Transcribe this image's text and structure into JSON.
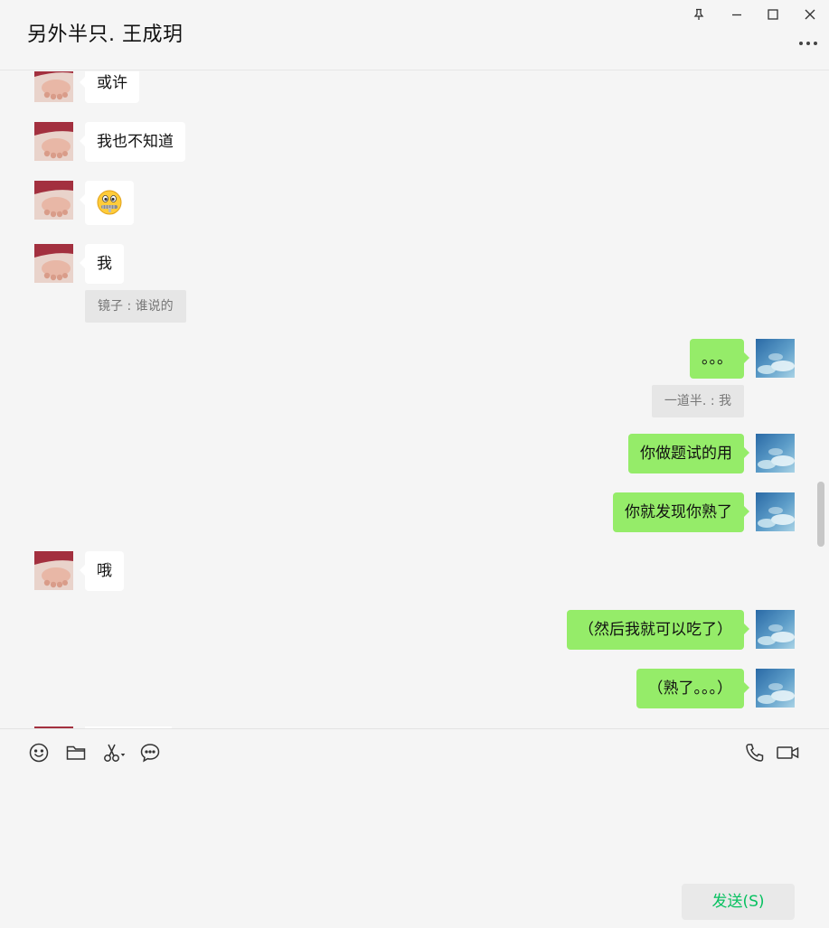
{
  "window": {
    "title": "另外半只. 王成玥"
  },
  "messages": [
    {
      "side": "in",
      "text": "或许"
    },
    {
      "side": "in",
      "text": "我也不知道"
    },
    {
      "side": "in",
      "emoji": "zipper-mouth-face"
    },
    {
      "side": "in",
      "text": "我",
      "quote": "镜子 : 谁说的"
    },
    {
      "side": "out",
      "text": "。。。",
      "quote": "一道半. : 我"
    },
    {
      "side": "out",
      "text": "你做题试的用"
    },
    {
      "side": "out",
      "text": "你就发现你熟了"
    },
    {
      "side": "in",
      "text": "哦"
    },
    {
      "side": "out",
      "text": "（然后我就可以吃了）"
    },
    {
      "side": "out",
      "text": "（熟了。。。）"
    }
  ],
  "toolbar": {
    "left_icons": [
      "emoji-icon",
      "folder-icon",
      "scissors-icon",
      "chat-bubble-icon"
    ],
    "right_icons": [
      "phone-icon",
      "video-call-icon"
    ]
  },
  "composer": {
    "value": "",
    "send_label": "发送(S)"
  },
  "colors": {
    "outgoing_bubble": "#95ec69",
    "incoming_bubble": "#ffffff",
    "send_text": "#07c160",
    "background": "#f5f5f5"
  }
}
